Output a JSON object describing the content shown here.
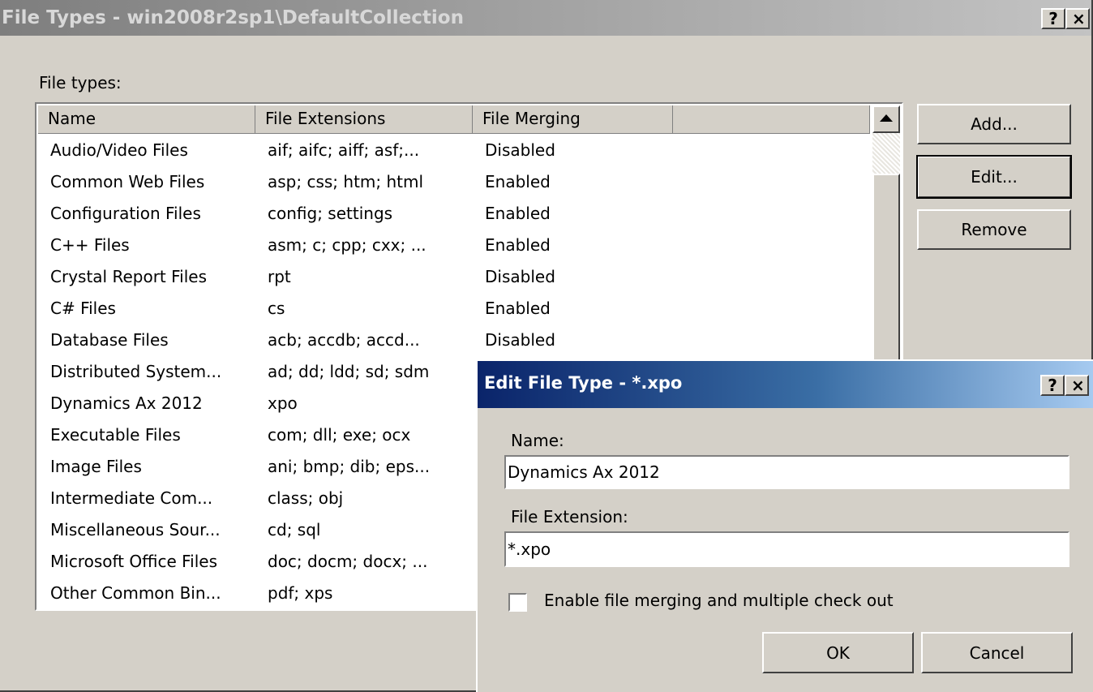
{
  "window": {
    "title": "File Types - win2008r2sp1\\DefaultCollection",
    "help_glyph": "?",
    "close_glyph": "×"
  },
  "list": {
    "label": "File types:",
    "columns": [
      "Name",
      "File Extensions",
      "File Merging"
    ],
    "rows": [
      {
        "name": "Audio/Video Files",
        "ext": "aif; aifc; aiff; asf;...",
        "merge": "Disabled"
      },
      {
        "name": "Common Web Files",
        "ext": "asp; css; htm; html",
        "merge": "Enabled"
      },
      {
        "name": "Configuration Files",
        "ext": "config; settings",
        "merge": "Enabled"
      },
      {
        "name": "C++ Files",
        "ext": "asm; c; cpp; cxx; ...",
        "merge": "Enabled"
      },
      {
        "name": "Crystal Report Files",
        "ext": "rpt",
        "merge": "Disabled"
      },
      {
        "name": "C# Files",
        "ext": "cs",
        "merge": "Enabled"
      },
      {
        "name": "Database Files",
        "ext": "acb; accdb; accd...",
        "merge": "Disabled"
      },
      {
        "name": "Distributed System...",
        "ext": "ad; dd; ldd; sd; sdm",
        "merge": ""
      },
      {
        "name": "Dynamics Ax 2012",
        "ext": "xpo",
        "merge": ""
      },
      {
        "name": "Executable Files",
        "ext": "com; dll; exe; ocx",
        "merge": ""
      },
      {
        "name": "Image Files",
        "ext": "ani; bmp; dib; eps...",
        "merge": ""
      },
      {
        "name": "Intermediate Com...",
        "ext": "class; obj",
        "merge": ""
      },
      {
        "name": "Miscellaneous Sour...",
        "ext": "cd; sql",
        "merge": ""
      },
      {
        "name": "Microsoft Office Files",
        "ext": "doc; docm; docx; ...",
        "merge": ""
      },
      {
        "name": "Other Common Bin...",
        "ext": "pdf; xps",
        "merge": ""
      }
    ]
  },
  "buttons": {
    "add": "Add...",
    "edit": "Edit...",
    "remove": "Remove"
  },
  "edit_dialog": {
    "title": "Edit File Type - *.xpo",
    "help_glyph": "?",
    "close_glyph": "×",
    "name_label": "Name:",
    "name_value": "Dynamics Ax 2012",
    "ext_label": "File Extension:",
    "ext_value": "*.xpo",
    "merge_checkbox_label": "Enable file merging and multiple check out",
    "merge_checked": false,
    "ok": "OK",
    "cancel": "Cancel"
  }
}
